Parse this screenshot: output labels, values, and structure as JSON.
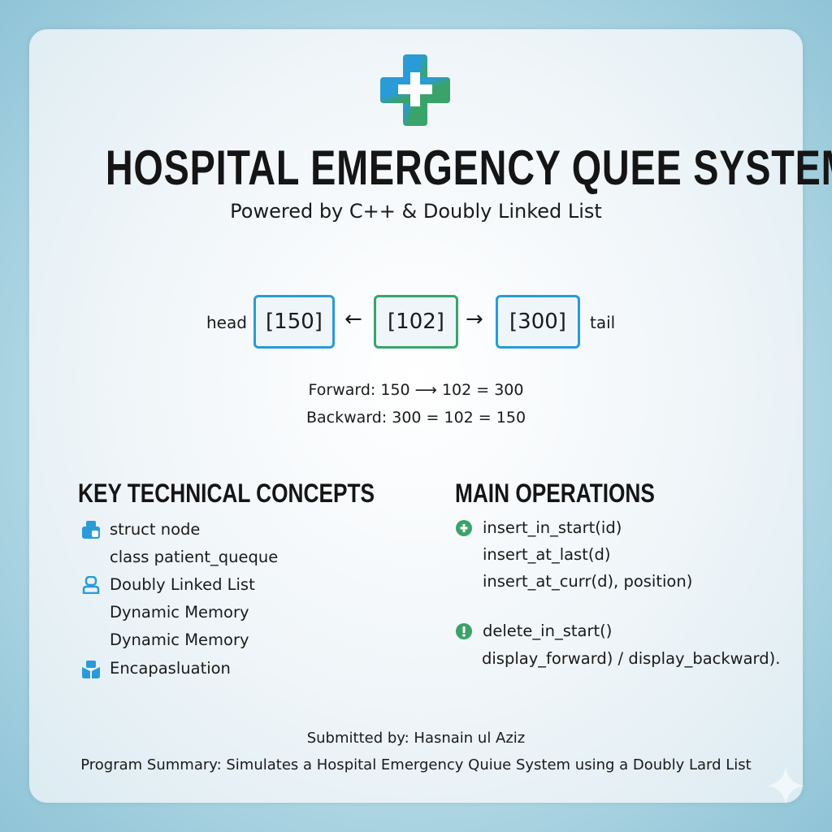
{
  "header": {
    "title": "HOSPITAL EMERGENCY QUEE SYSTEM",
    "subtitle": "Powered by C++ & Doubly Linked List"
  },
  "diagram": {
    "head_label": "head",
    "tail_label": "tail",
    "nodes": [
      "[150]",
      "[102]",
      "[300]"
    ],
    "arrow_left": "←",
    "arrow_right": "→",
    "forward": "Forward: 150 ⟶ 102 = 300",
    "backward": "Backward: 300 = 102 = 150"
  },
  "concepts": {
    "title": "KEY TECHNICAL CONCEPTS",
    "items": [
      "struct node",
      "class patient_queque",
      "Doubly Linked List",
      "Dynamic Memory",
      "Dynamic Memory",
      "Encapasluation"
    ]
  },
  "operations": {
    "title": "MAIN OPERATIONS",
    "items": [
      "insert_in_start(id)",
      "insert_at_last(d)",
      "insert_at_curr(d), position)",
      "delete_in_start()",
      "display_forward) / display_backward)."
    ]
  },
  "footer": {
    "submitted": "Submitted by: Hasnain ul Aziz",
    "summary": "Program Summary: Simulates a Hospital Emergency Quiue System using a Doubly Lard List"
  },
  "colors": {
    "blue": "#2a9bd6",
    "green": "#3aa36a"
  }
}
